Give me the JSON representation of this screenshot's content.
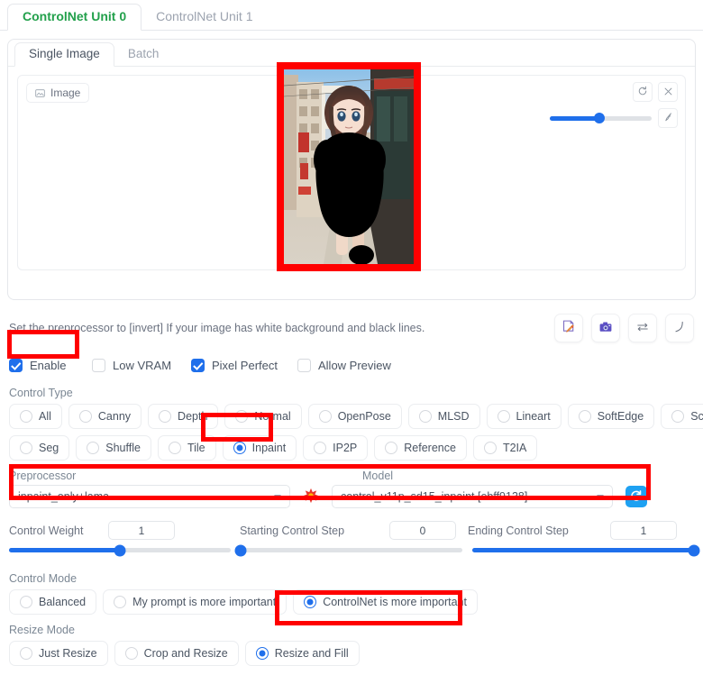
{
  "unit_tabs": [
    {
      "label": "ControlNet Unit 0",
      "active": true
    },
    {
      "label": "ControlNet Unit 1",
      "active": false
    }
  ],
  "sub_tabs": [
    {
      "label": "Single Image",
      "active": true
    },
    {
      "label": "Batch",
      "active": false
    }
  ],
  "image_panel": {
    "badge_label": "Image",
    "brush_slider_percent": 49,
    "buttons": {
      "undo": "undo-icon",
      "close": "close-icon",
      "brush": "brush-icon"
    }
  },
  "hint": {
    "text": "Set the preprocessor to [invert] If your image has white background and black lines.",
    "icons": [
      "edit-image-icon",
      "camera-icon",
      "swap-icon",
      "curve-icon"
    ]
  },
  "checkboxes": [
    {
      "label": "Enable",
      "checked": true
    },
    {
      "label": "Low VRAM",
      "checked": false
    },
    {
      "label": "Pixel Perfect",
      "checked": true
    },
    {
      "label": "Allow Preview",
      "checked": false
    }
  ],
  "control_type": {
    "label": "Control Type",
    "row1": [
      {
        "label": "All",
        "selected": false
      },
      {
        "label": "Canny",
        "selected": false
      },
      {
        "label": "Depth",
        "selected": false
      },
      {
        "label": "Normal",
        "selected": false
      },
      {
        "label": "OpenPose",
        "selected": false
      },
      {
        "label": "MLSD",
        "selected": false
      },
      {
        "label": "Lineart",
        "selected": false
      },
      {
        "label": "SoftEdge",
        "selected": false
      },
      {
        "label": "Scribble",
        "selected": false
      }
    ],
    "row2": [
      {
        "label": "Seg",
        "selected": false
      },
      {
        "label": "Shuffle",
        "selected": false
      },
      {
        "label": "Tile",
        "selected": false
      },
      {
        "label": "Inpaint",
        "selected": true
      },
      {
        "label": "IP2P",
        "selected": false
      },
      {
        "label": "Reference",
        "selected": false
      },
      {
        "label": "T2IA",
        "selected": false
      }
    ]
  },
  "preprocessor": {
    "label": "Preprocessor",
    "value": "inpaint_only+lama"
  },
  "model": {
    "label": "Model",
    "value": "control_v11p_sd15_inpaint [ebff9138]"
  },
  "run_icon": "explosion-icon",
  "refresh_icon": "refresh-icon",
  "sliders": [
    {
      "name": "Control Weight",
      "value": "1",
      "percent": 50
    },
    {
      "name": "Starting Control Step",
      "value": "0",
      "percent": 0
    },
    {
      "name": "Ending Control Step",
      "value": "1",
      "percent": 100
    }
  ],
  "control_mode": {
    "label": "Control Mode",
    "options": [
      {
        "label": "Balanced",
        "selected": false
      },
      {
        "label": "My prompt is more important",
        "selected": false
      },
      {
        "label": "ControlNet is more important",
        "selected": true
      }
    ]
  },
  "resize_mode": {
    "label": "Resize Mode",
    "options": [
      {
        "label": "Just Resize",
        "selected": false
      },
      {
        "label": "Crop and Resize",
        "selected": false
      },
      {
        "label": "Resize and Fill",
        "selected": true
      }
    ]
  },
  "colors": {
    "accent_blue": "#1f6feb",
    "annotation_red": "#ff0000",
    "active_tab_green": "#22a04b",
    "refresh_blue": "#1ea1f2"
  }
}
